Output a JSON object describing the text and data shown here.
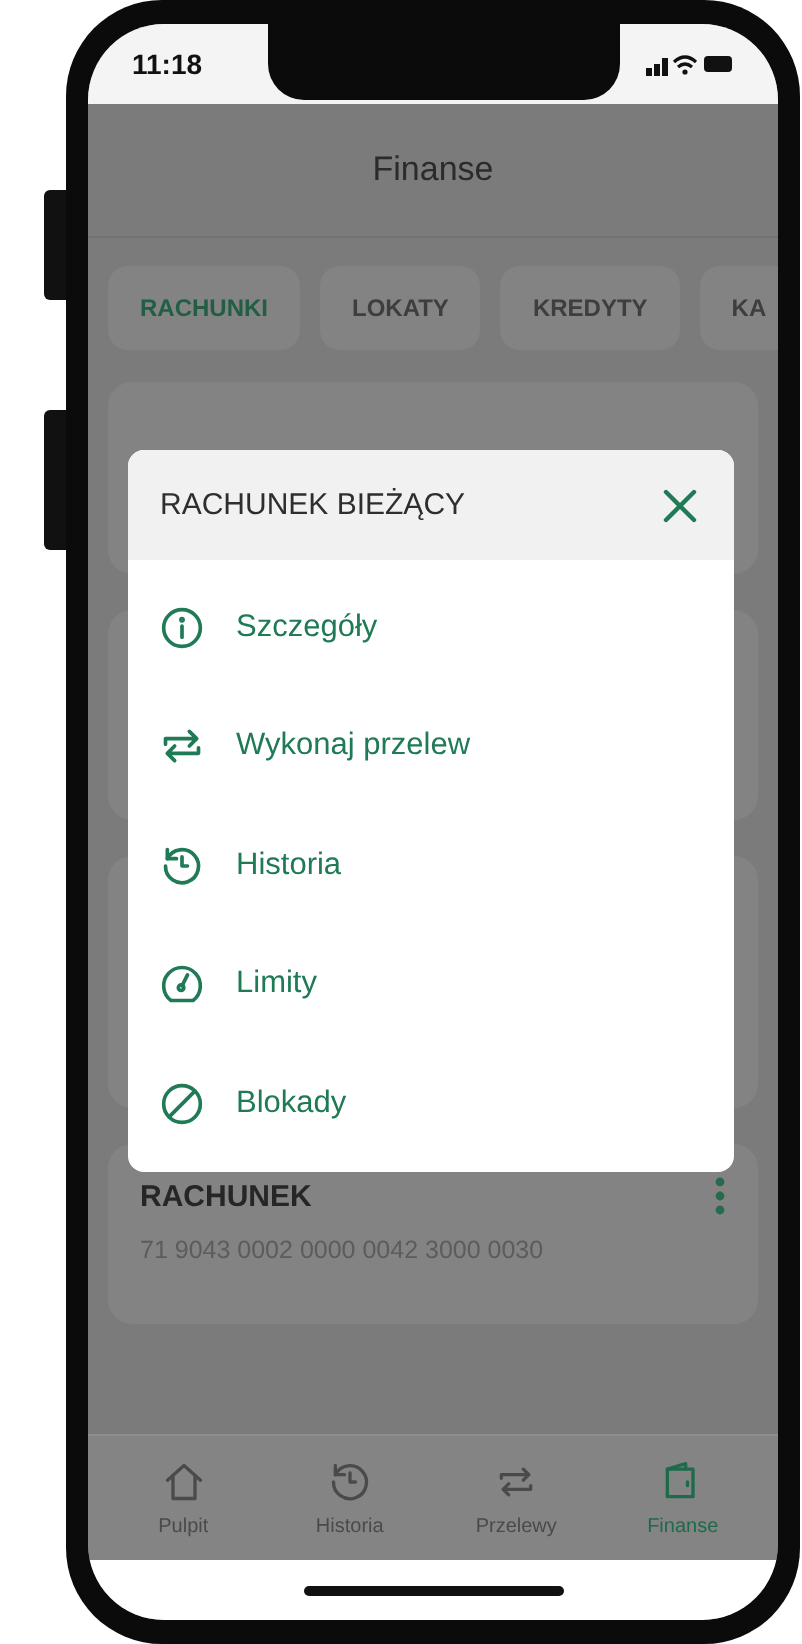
{
  "status_bar": {
    "time": "11:18"
  },
  "header": {
    "title": "Finanse"
  },
  "tabs": [
    {
      "label": "RACHUNKI",
      "selected": true
    },
    {
      "label": "LOKATY",
      "selected": false
    },
    {
      "label": "KREDYTY",
      "selected": false
    },
    {
      "label": "KA",
      "selected": false
    }
  ],
  "account_card": {
    "title": "RACHUNEK",
    "number": "71 9043 0002 0000 0042 3000 0030"
  },
  "modal": {
    "title": "RACHUNEK BIEŻĄCY",
    "items": [
      {
        "label": "Szczegóły",
        "kind": "info"
      },
      {
        "label": "Wykonaj przelew",
        "kind": "transfer"
      },
      {
        "label": "Historia",
        "kind": "history"
      },
      {
        "label": "Limity",
        "kind": "gauge"
      },
      {
        "label": "Blokady",
        "kind": "block"
      }
    ]
  },
  "nav": [
    {
      "label": "Pulpit",
      "kind": "home",
      "selected": false
    },
    {
      "label": "Historia",
      "kind": "history",
      "selected": false
    },
    {
      "label": "Przelewy",
      "kind": "transfer",
      "selected": false
    },
    {
      "label": "Finanse",
      "kind": "wallet",
      "selected": true
    }
  ]
}
